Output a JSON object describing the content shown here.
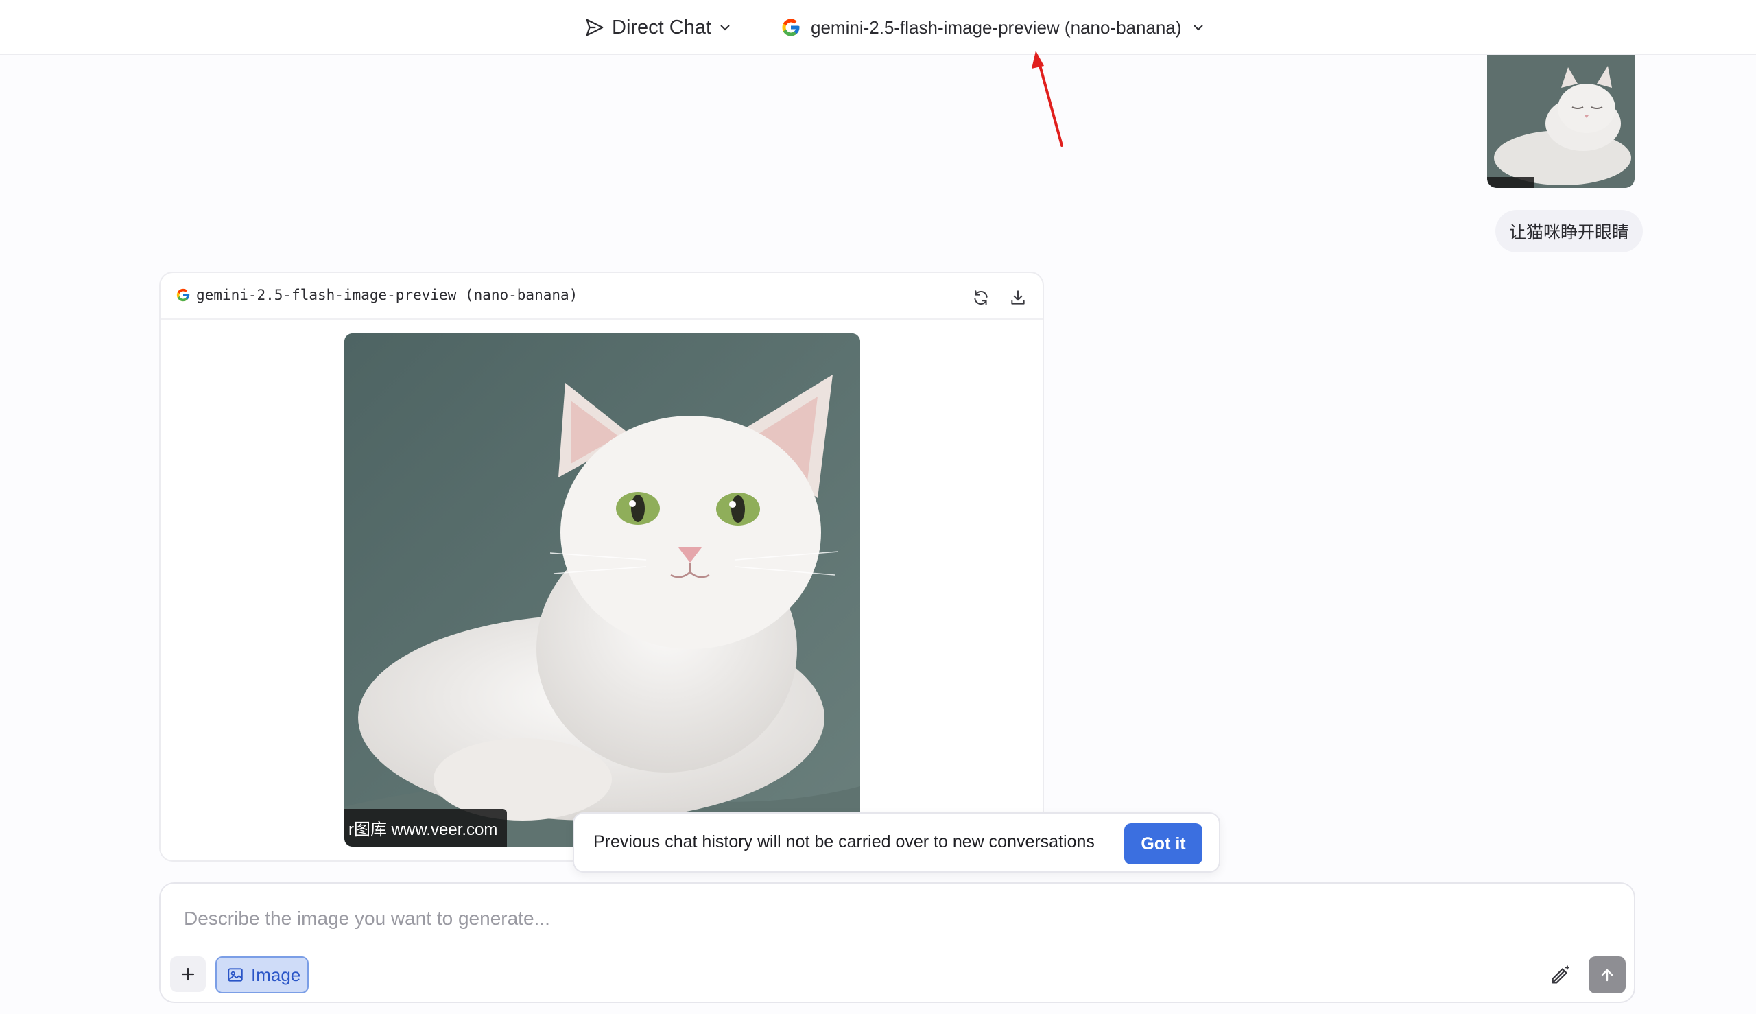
{
  "header": {
    "mode_label": "Direct Chat",
    "model_label": "gemini-2.5-flash-image-preview (nano-banana)"
  },
  "user_message": {
    "text": "让猫咪睁开眼睛",
    "thumbnail_watermark": "veer.com"
  },
  "response": {
    "model_name": "gemini-2.5-flash-image-preview (nano-banana)",
    "image_watermark": "r图库 www.veer.com"
  },
  "toast": {
    "message": "Previous chat history will not be carried over to new conversations",
    "button_label": "Got it"
  },
  "composer": {
    "placeholder": "Describe the image you want to generate...",
    "value": "",
    "mode_chip_label": "Image"
  },
  "colors": {
    "accent": "#3b6fe0",
    "annotation_arrow": "#e0201e",
    "chip_bg": "#cfdcf8"
  }
}
